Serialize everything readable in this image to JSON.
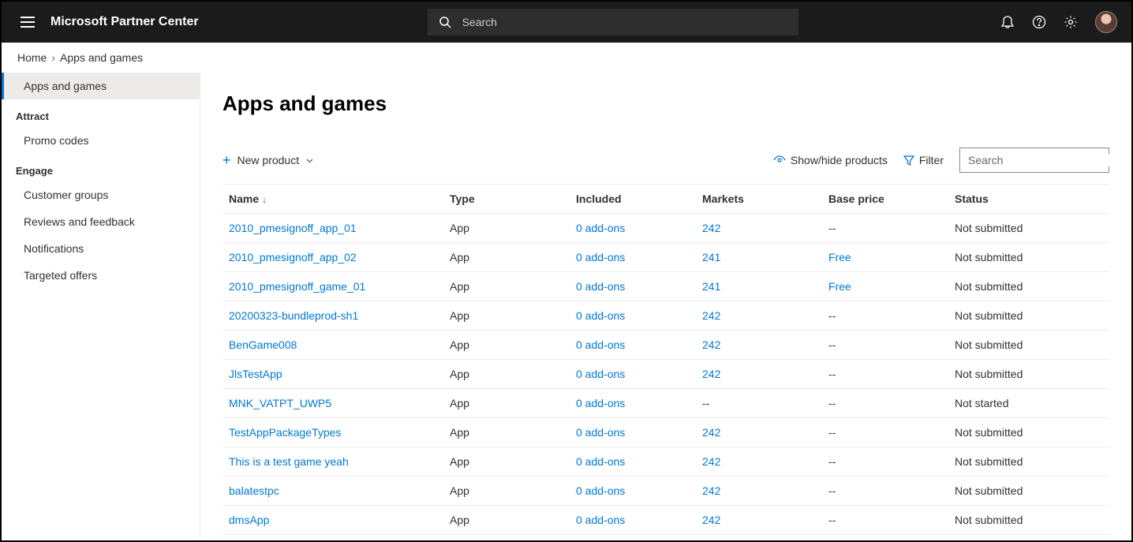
{
  "header": {
    "brand": "Microsoft Partner Center",
    "search_placeholder": "Search"
  },
  "breadcrumb": {
    "home": "Home",
    "current": "Apps and games"
  },
  "sidebar": {
    "top_item": "Apps and games",
    "sections": [
      {
        "heading": "Attract",
        "items": [
          "Promo codes"
        ]
      },
      {
        "heading": "Engage",
        "items": [
          "Customer groups",
          "Reviews and feedback",
          "Notifications",
          "Targeted offers"
        ]
      }
    ]
  },
  "page": {
    "title": "Apps and games",
    "new_product": "New product",
    "show_hide": "Show/hide products",
    "filter": "Filter",
    "search_placeholder": "Search"
  },
  "table": {
    "headers": {
      "name": "Name",
      "type": "Type",
      "included": "Included",
      "markets": "Markets",
      "baseprice": "Base price",
      "status": "Status"
    },
    "rows": [
      {
        "name": "2010_pmesignoff_app_01",
        "type": "App",
        "included": "0 add-ons",
        "markets": "242",
        "baseprice": "--",
        "status": "Not submitted"
      },
      {
        "name": "2010_pmesignoff_app_02",
        "type": "App",
        "included": "0 add-ons",
        "markets": "241",
        "baseprice": "Free",
        "status": "Not submitted"
      },
      {
        "name": "2010_pmesignoff_game_01",
        "type": "App",
        "included": "0 add-ons",
        "markets": "241",
        "baseprice": "Free",
        "status": "Not submitted"
      },
      {
        "name": "20200323-bundleprod-sh1",
        "type": "App",
        "included": "0 add-ons",
        "markets": "242",
        "baseprice": "--",
        "status": "Not submitted"
      },
      {
        "name": "BenGame008",
        "type": "App",
        "included": "0 add-ons",
        "markets": "242",
        "baseprice": "--",
        "status": "Not submitted"
      },
      {
        "name": "JlsTestApp",
        "type": "App",
        "included": "0 add-ons",
        "markets": "242",
        "baseprice": "--",
        "status": "Not submitted"
      },
      {
        "name": "MNK_VATPT_UWP5",
        "type": "App",
        "included": "0 add-ons",
        "markets": "--",
        "baseprice": "--",
        "status": "Not started"
      },
      {
        "name": "TestAppPackageTypes",
        "type": "App",
        "included": "0 add-ons",
        "markets": "242",
        "baseprice": "--",
        "status": "Not submitted"
      },
      {
        "name": "This is a test game yeah",
        "type": "App",
        "included": "0 add-ons",
        "markets": "242",
        "baseprice": "--",
        "status": "Not submitted"
      },
      {
        "name": "balatestpc",
        "type": "App",
        "included": "0 add-ons",
        "markets": "242",
        "baseprice": "--",
        "status": "Not submitted"
      },
      {
        "name": "dmsApp",
        "type": "App",
        "included": "0 add-ons",
        "markets": "242",
        "baseprice": "--",
        "status": "Not submitted"
      }
    ]
  }
}
